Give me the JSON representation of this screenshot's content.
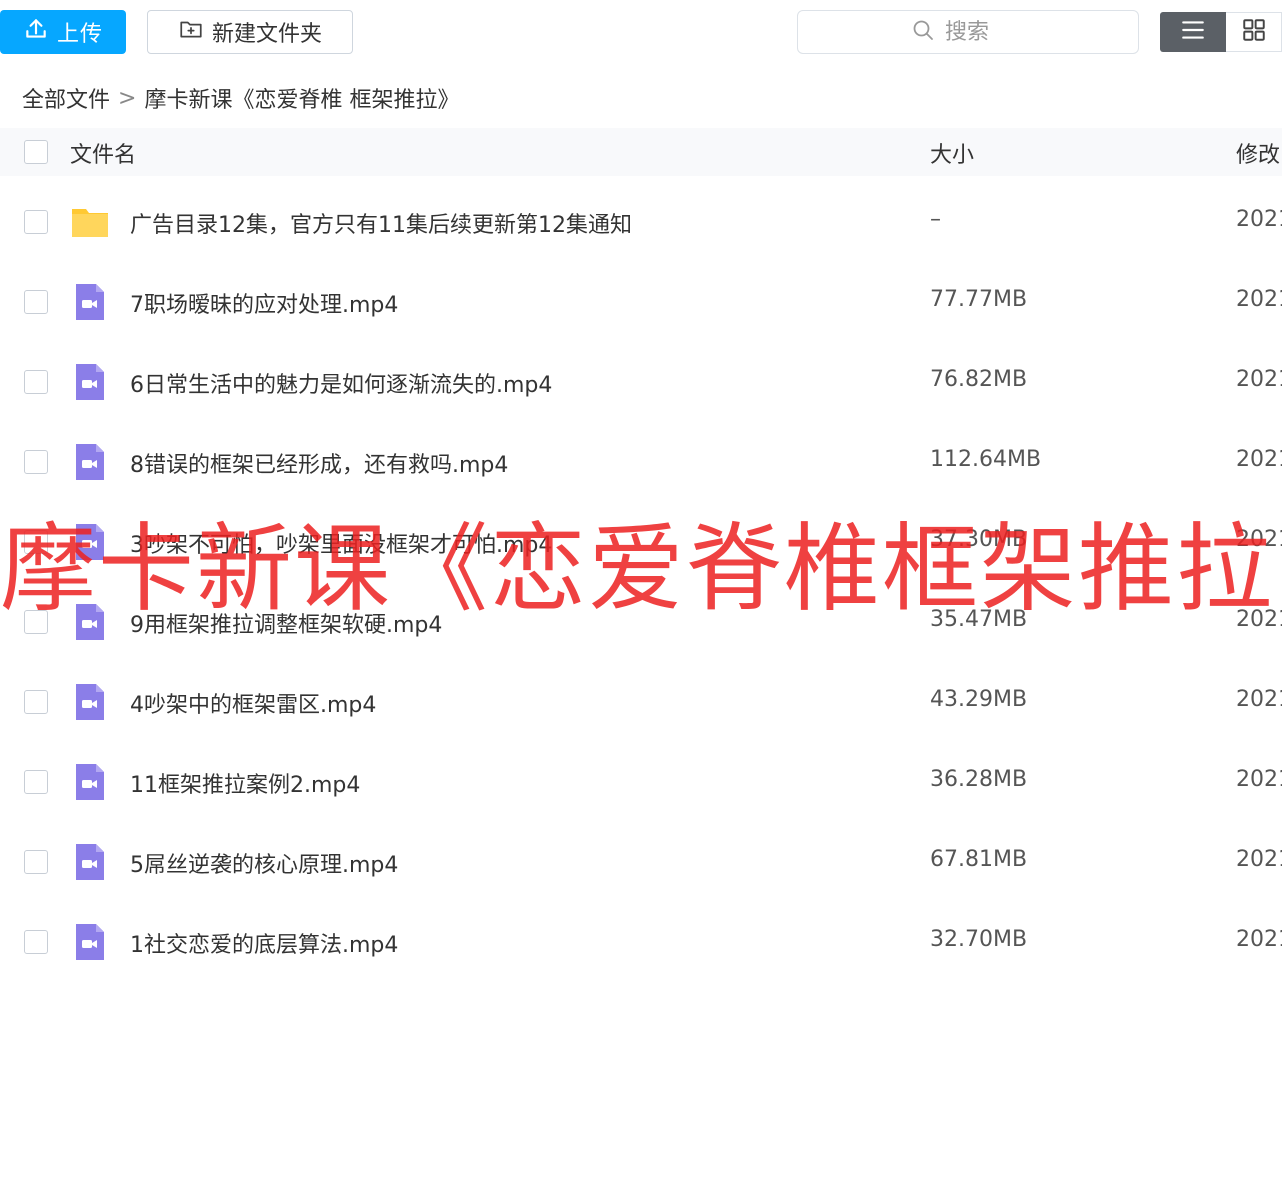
{
  "toolbar": {
    "upload_label": "上传",
    "new_folder_label": "新建文件夹",
    "search_placeholder": "搜索",
    "upload_color": "#06a7ff"
  },
  "breadcrumb": {
    "root": "全部文件",
    "separator": ">",
    "current": "摩卡新课《恋爱脊椎 框架推拉》"
  },
  "table": {
    "headers": {
      "name": "文件名",
      "size": "大小",
      "modified": "修改"
    },
    "rows": [
      {
        "type": "folder",
        "icon": "folder-icon",
        "name": "广告目录12集，官方只有11集后续更新第12集通知",
        "size": "–",
        "date": "2021"
      },
      {
        "type": "video",
        "icon": "video-file-icon",
        "name": "7职场暧昧的应对处理.mp4",
        "size": "77.77MB",
        "date": "2021"
      },
      {
        "type": "video",
        "icon": "video-file-icon",
        "name": "6日常生活中的魅力是如何逐渐流失的.mp4",
        "size": "76.82MB",
        "date": "2021"
      },
      {
        "type": "video",
        "icon": "video-file-icon",
        "name": "8错误的框架已经形成，还有救吗.mp4",
        "size": "112.64MB",
        "date": "2021"
      },
      {
        "type": "video",
        "icon": "video-file-icon",
        "name": "3吵架不可怕，吵架里面没框架才可怕.mp4",
        "size": "37.30MB",
        "date": "2021"
      },
      {
        "type": "video",
        "icon": "video-file-icon",
        "name": "9用框架推拉调整框架软硬.mp4",
        "size": "35.47MB",
        "date": "2021"
      },
      {
        "type": "video",
        "icon": "video-file-icon",
        "name": "4吵架中的框架雷区.mp4",
        "size": "43.29MB",
        "date": "2021"
      },
      {
        "type": "video",
        "icon": "video-file-icon",
        "name": "11框架推拉案例2.mp4",
        "size": "36.28MB",
        "date": "2021"
      },
      {
        "type": "video",
        "icon": "video-file-icon",
        "name": "5屌丝逆袭的核心原理.mp4",
        "size": "67.81MB",
        "date": "2021"
      },
      {
        "type": "video",
        "icon": "video-file-icon",
        "name": "1社交恋爱的底层算法.mp4",
        "size": "32.70MB",
        "date": "2021"
      }
    ]
  },
  "watermark": {
    "text": "摩卡新课《恋爱脊椎框架推拉",
    "color": "#ec2020"
  },
  "colors": {
    "folder": "#ffc933",
    "video": "#8b7ee8"
  }
}
